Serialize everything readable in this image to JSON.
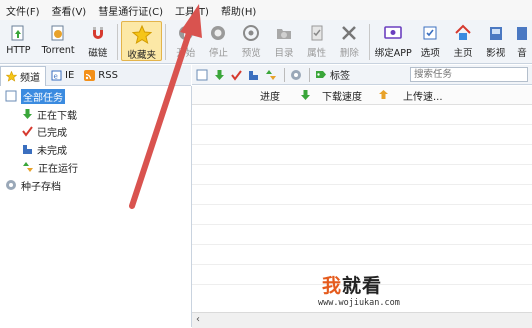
{
  "menu": [
    "文件(F)",
    "查看(V)",
    "彗星通行证(C)",
    "工具(T)",
    "帮助(H)"
  ],
  "toolbar": {
    "items": [
      {
        "label": "HTTP",
        "icon": "add-http-icon"
      },
      {
        "label": "Torrent",
        "icon": "add-torrent-icon"
      },
      {
        "label": "磁链",
        "icon": "magnet-icon"
      },
      {
        "label": "收藏夹",
        "icon": "star-icon",
        "selected": true
      },
      {
        "label": "开始",
        "icon": "play-icon",
        "disabled": true
      },
      {
        "label": "停止",
        "icon": "stop-icon",
        "disabled": true
      },
      {
        "label": "预览",
        "icon": "preview-icon",
        "disabled": true
      },
      {
        "label": "目录",
        "icon": "folder-icon",
        "disabled": true
      },
      {
        "label": "属性",
        "icon": "properties-icon",
        "disabled": true
      },
      {
        "label": "删除",
        "icon": "delete-icon",
        "disabled": true
      },
      {
        "label": "绑定APP",
        "icon": "bind-app-icon"
      },
      {
        "label": "选项",
        "icon": "options-icon"
      },
      {
        "label": "主页",
        "icon": "home-icon"
      },
      {
        "label": "影视",
        "icon": "video-icon"
      },
      {
        "label": "音",
        "icon": "music-icon"
      }
    ]
  },
  "left_tabs": [
    {
      "label": "频道",
      "icon": "star-icon",
      "active": true
    },
    {
      "label": "IE",
      "icon": "ie-icon"
    },
    {
      "label": "RSS",
      "icon": "rss-icon"
    }
  ],
  "tree": {
    "root": "全部任务",
    "children": [
      "正在下载",
      "已完成",
      "未完成",
      "正在运行"
    ],
    "archive": "种子存档"
  },
  "task_toolbar": {
    "tag_label": "标签",
    "search_placeholder": "搜索任务"
  },
  "columns": {
    "progress": "进度",
    "download_speed": "下载速度",
    "upload_speed": "上传速..."
  },
  "watermark": {
    "brand_a": "我",
    "brand_b": "就看",
    "url": "www.wojiukan.com"
  },
  "colors": {
    "accent": "#3b8be0",
    "arrow": "#d9534f",
    "watermark": "#e55b1d"
  }
}
